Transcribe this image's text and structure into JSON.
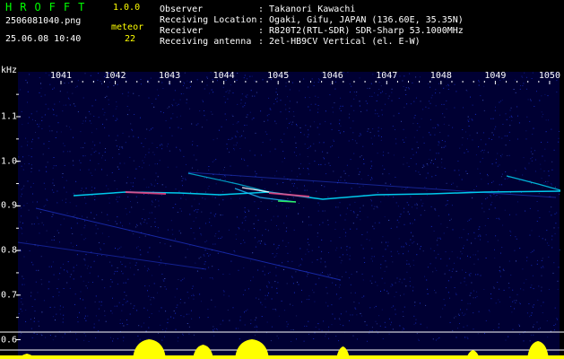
{
  "header": {
    "app_name": "HROFFT",
    "version": "1.0.0",
    "filename": "2506081040.png",
    "datetime": "25.06.08 10:40",
    "meteor_label": "meteor",
    "meteor_count": "22",
    "info": [
      {
        "label": "Observer",
        "value": ": Takanori Kawachi"
      },
      {
        "label": "Receiving Location",
        "value": ": Ogaki, Gifu, JAPAN (136.60E, 35.35N)"
      },
      {
        "label": "Receiver",
        "value": ": R820T2(RTL-SDR) SDR-Sharp 53.1000MHz"
      },
      {
        "label": "Receiving antenna",
        "value": ": 2el-HB9CV Vertical (el. E-W)"
      }
    ]
  },
  "chart_data": {
    "type": "heatmap",
    "ylabel": "kHz",
    "x_ticks": [
      "1041",
      "1042",
      "1043",
      "1044",
      "1045",
      "1046",
      "1047",
      "1048",
      "1049",
      "1050"
    ],
    "y_ticks": [
      "1.1",
      "1.0",
      "0.9",
      "0.8",
      "0.7",
      "0.6"
    ],
    "xlim": [
      1040.75,
      1050.25
    ],
    "ylim": [
      0.59,
      1.2
    ],
    "colors": {
      "background": "#000033",
      "noise": "#2040ff",
      "signal": "#00e0ff",
      "hot": "#ff4080",
      "spectrum": "#ffff00",
      "grid": "#ffffff"
    }
  }
}
